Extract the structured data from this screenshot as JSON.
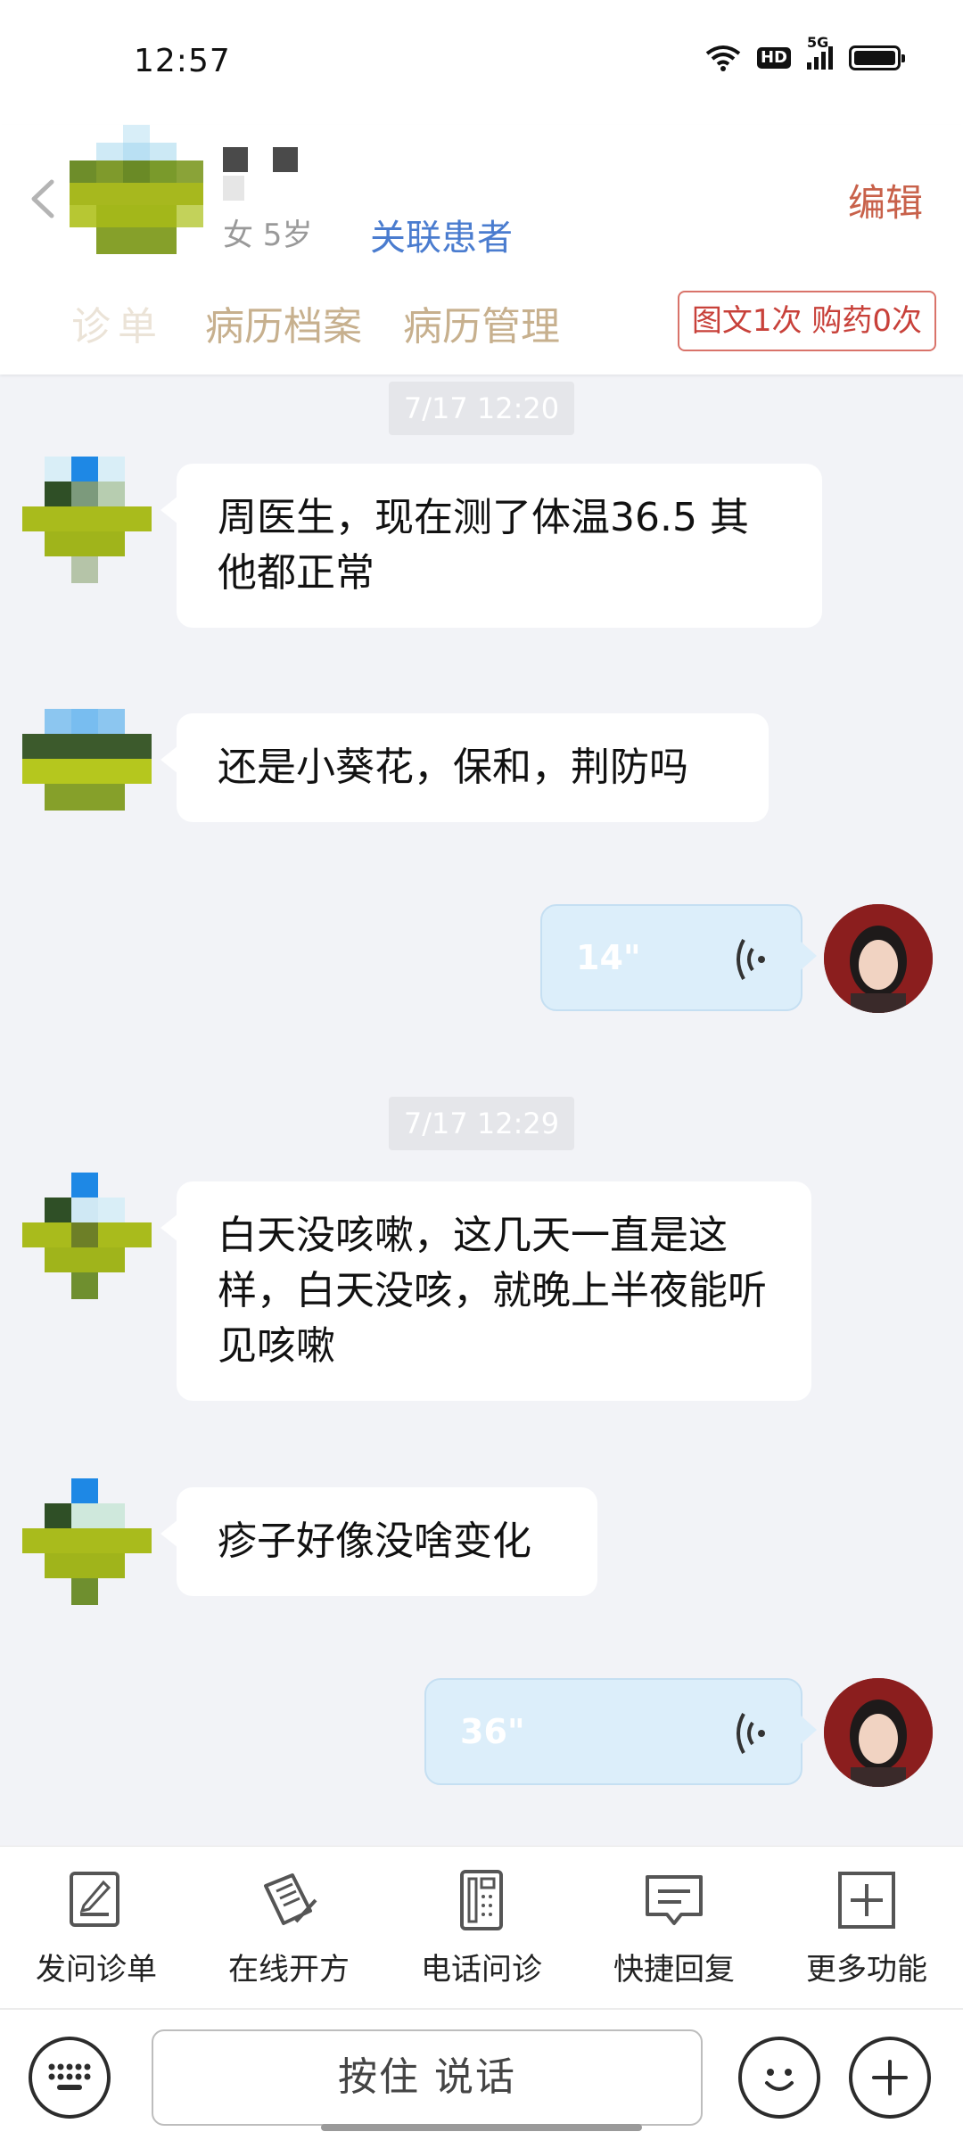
{
  "status_bar": {
    "time": "12:57",
    "hd": "HD",
    "network": "5G"
  },
  "header": {
    "age_text": "女 5岁",
    "link_label": "关联患者",
    "edit_label": "编辑",
    "tabs": [
      "病历档案",
      "病历管理"
    ],
    "first_tab_partial": "诊单",
    "stats_badge": "图文1次 购药0次"
  },
  "chat": {
    "messages": [
      {
        "type": "time",
        "text": "7/17 12:20"
      },
      {
        "type": "text",
        "side": "left",
        "text": "周医生，现在测了体温36.5 其他都正常"
      },
      {
        "type": "text",
        "side": "left",
        "text": "还是小葵花，保和，荆防吗"
      },
      {
        "type": "voice",
        "side": "right",
        "duration": "14\""
      },
      {
        "type": "time",
        "text": "7/17 12:29"
      },
      {
        "type": "text",
        "side": "left",
        "text": "白天没咳嗽，这几天一直是这样，白天没咳，就晚上半夜能听见咳嗽"
      },
      {
        "type": "text",
        "side": "left",
        "text": "疹子好像没啥变化"
      },
      {
        "type": "voice",
        "side": "right",
        "duration": "36\""
      }
    ]
  },
  "toolbar": {
    "items": [
      {
        "label": "发问诊单",
        "icon": "form-icon"
      },
      {
        "label": "在线开方",
        "icon": "prescription-icon"
      },
      {
        "label": "电话问诊",
        "icon": "phone-icon"
      },
      {
        "label": "快捷回复",
        "icon": "quick-reply-icon"
      },
      {
        "label": "更多功能",
        "icon": "more-icon"
      }
    ]
  },
  "input": {
    "talk_label": "按住 说话"
  },
  "colors": {
    "accent_link": "#4a7ccf",
    "edit": "#c8614a",
    "tab": "#c7b08e",
    "badge": "#c8413a",
    "voice_bubble": "#dceefa"
  }
}
